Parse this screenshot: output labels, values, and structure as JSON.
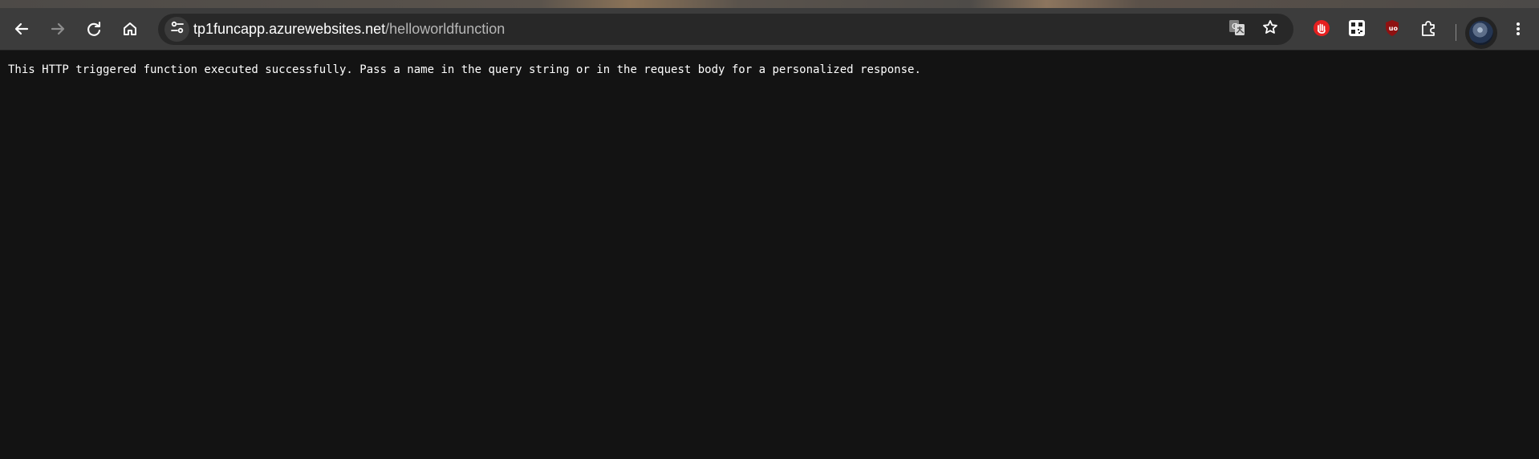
{
  "browser": {
    "toolbar": {
      "back_icon": "back-arrow-icon",
      "forward_icon": "forward-arrow-icon",
      "reload_icon": "reload-icon",
      "home_icon": "home-icon"
    },
    "address_bar": {
      "domain": "tp1funcapp.azurewebsites.net",
      "path": "/helloworldfunction",
      "site_info_icon": "site-settings-icon",
      "translate_icon": "translate-icon",
      "bookmark_icon": "star-icon"
    },
    "extensions": [
      {
        "icon": "red-hand-extension-icon",
        "color": "#e51f1f"
      },
      {
        "icon": "qr-code-extension-icon",
        "color": "#ffffff"
      },
      {
        "icon": "ublock-origin-icon",
        "label": "uo",
        "color": "#8f1111"
      },
      {
        "icon": "puzzle-extensions-icon",
        "color": "#d6d6d6"
      }
    ],
    "profile": {
      "icon": "profile-avatar-icon"
    },
    "menu_icon": "three-dot-menu-icon"
  },
  "page": {
    "message": "This HTTP triggered function executed successfully. Pass a name in the query string or in the request body for a personalized response."
  },
  "colors": {
    "page_background": "#131313",
    "toolbar_background": "#3c3c3c",
    "omnibox_background": "#282828",
    "url_path": "#b7b7b7"
  }
}
